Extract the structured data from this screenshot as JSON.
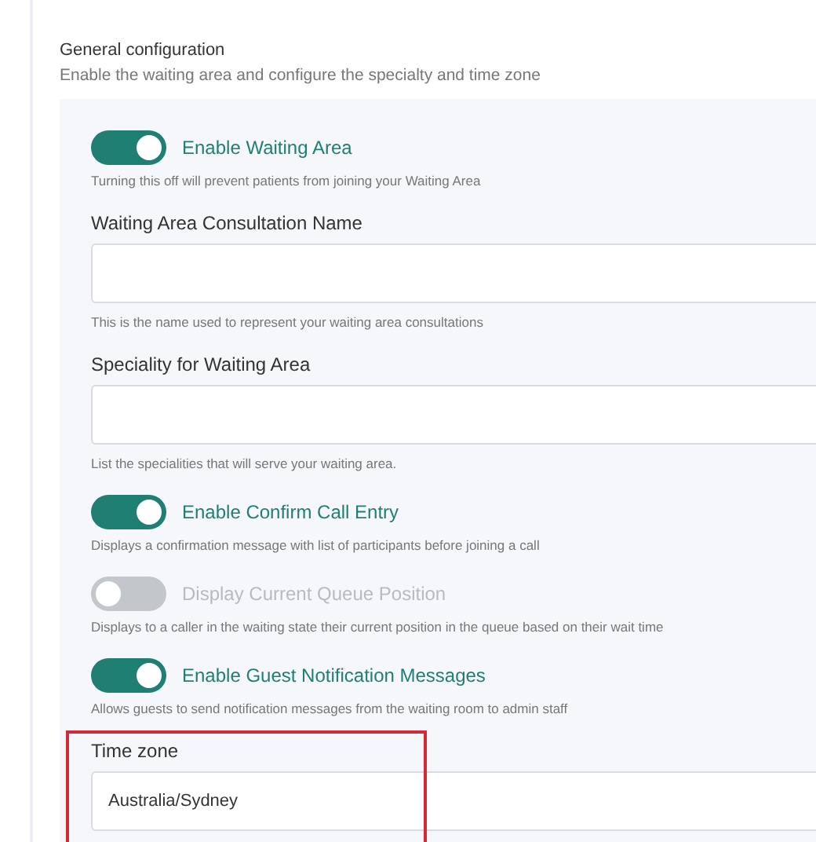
{
  "section": {
    "title": "General configuration",
    "subtitle": "Enable the waiting area and configure the specialty and time zone"
  },
  "settings": [
    {
      "kind": "toggle",
      "label": "Enable Waiting Area",
      "on": true,
      "hint": "Turning this off will prevent patients from joining your Waiting Area"
    },
    {
      "kind": "field",
      "label": "Waiting Area Consultation Name",
      "hint": "This is the name used to represent your waiting area consultations",
      "highlighted": false
    },
    {
      "kind": "field",
      "label": "Speciality for Waiting Area",
      "hint": "List the specialities that will serve your waiting area.",
      "highlighted": false
    },
    {
      "kind": "toggle",
      "label": "Enable Confirm Call Entry",
      "on": true,
      "hint": "Displays a confirmation message with list of participants before joining a call"
    },
    {
      "kind": "toggle",
      "label": "Display Current Queue Position",
      "on": false,
      "hint": "Displays to a caller in the waiting state their current position in the queue based on their wait time"
    },
    {
      "kind": "toggle",
      "label": "Enable Guest Notification Messages",
      "on": true,
      "hint": "Allows guests to send notification messages from the waiting room to admin staff"
    },
    {
      "kind": "field",
      "label": "Time zone",
      "value": "Australia/Sydney",
      "highlighted": true
    }
  ]
}
